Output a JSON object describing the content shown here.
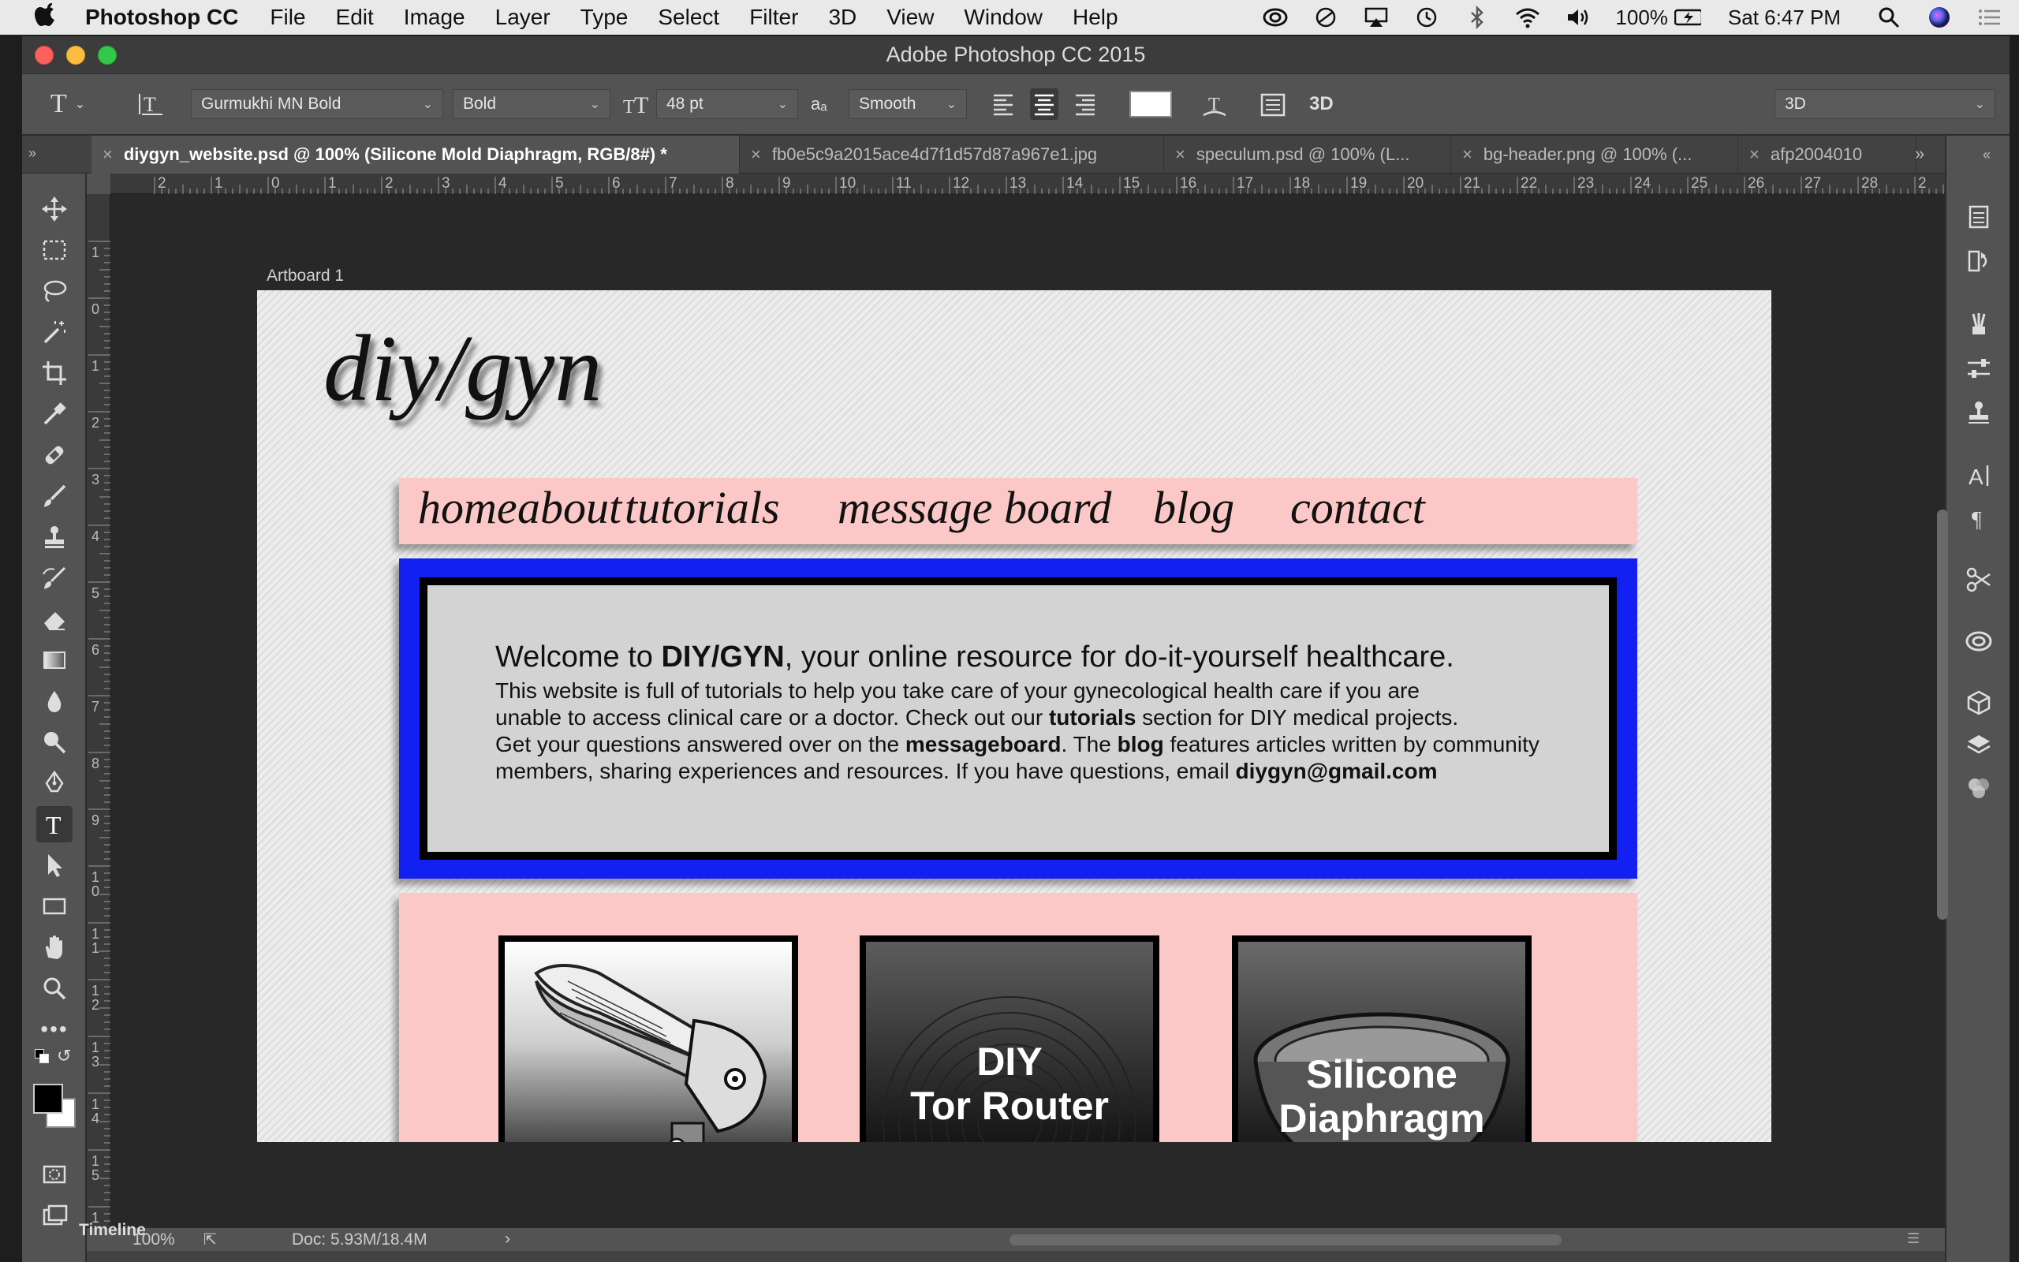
{
  "menubar": {
    "app_name": "Photoshop CC",
    "items": [
      "File",
      "Edit",
      "Image",
      "Layer",
      "Type",
      "Select",
      "Filter",
      "3D",
      "View",
      "Window",
      "Help"
    ],
    "battery": "100%",
    "clock": "Sat 6:47 PM"
  },
  "window": {
    "title": "Adobe Photoshop CC 2015"
  },
  "options": {
    "font_family": "Gurmukhi MN Bold",
    "font_style": "Bold",
    "font_size": "48 pt",
    "aa_label": "aₐ",
    "antialias": "Smooth",
    "workspace": "3D",
    "text_color": "#ffffff"
  },
  "tabs": [
    "diygyn_website.psd @ 100% (Silicone Mold Diaphragm, RGB/8#) *",
    "fb0e5c9a2015ace4d7f1d57d87a967e1.jpg",
    "speculum.psd @ 100% (L...",
    "bg-header.png @ 100% (...",
    "afp2004010"
  ],
  "ruler": {
    "h_ticks": [
      "2",
      "1",
      "0",
      "1",
      "2",
      "3",
      "4",
      "5",
      "6",
      "7",
      "8",
      "9",
      "10",
      "11",
      "12",
      "13",
      "14",
      "15",
      "16",
      "17",
      "18",
      "19",
      "20",
      "21",
      "22",
      "23",
      "24",
      "25",
      "26",
      "27",
      "28",
      "2"
    ],
    "v_ticks": [
      "1",
      "0",
      "1",
      "2",
      "3",
      "4",
      "5",
      "6",
      "7",
      "8",
      "9",
      "1\n0",
      "1\n1",
      "1\n2",
      "1\n3",
      "1\n4",
      "1\n5",
      "1"
    ]
  },
  "canvas": {
    "artboard_label": "Artboard 1"
  },
  "site": {
    "logo": "diy/gyn",
    "nav": [
      "home",
      "about",
      "tutorials",
      "message board",
      "blog",
      "contact"
    ],
    "welcome": {
      "head_pre": "Welcome to ",
      "head_bold": "DIY/GYN",
      "head_post": ", your online resource for do-it-yourself healthcare.",
      "line1": "This website is full of tutorials to help you take care of your gynecological health care if you are",
      "line2_pre": "unable to access clinical care or a doctor. Check out our ",
      "line2_bold": "tutorials",
      "line2_post": " section for DIY medical projects.",
      "line3_a": "Get your questions answered over on the ",
      "line3_b": "messageboard",
      "line3_c": ". The ",
      "line3_d": "blog",
      "line3_e": " features articles written by community",
      "line4_pre": " members, sharing experiences and resources. If you have questions, email ",
      "line4_bold": "diygyn@gmail.com"
    },
    "products": [
      {
        "label": ""
      },
      {
        "label_1": "DIY",
        "label_2": "Tor Router"
      },
      {
        "label_1": "Silicone",
        "label_2": "Diaphragm"
      }
    ]
  },
  "status": {
    "zoom": "100%",
    "doc": "Doc: 5.93M/18.4M"
  },
  "timeline": {
    "label": "Timeline"
  },
  "colors": {
    "nav_bg": "#fcc7c7",
    "welcome_border": "#1320f2",
    "welcome_bg": "#d3d3d3"
  }
}
